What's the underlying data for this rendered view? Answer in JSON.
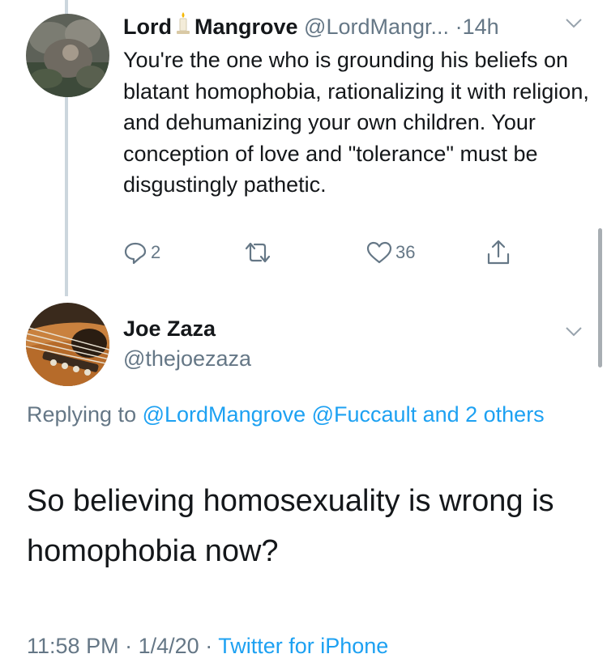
{
  "tweet1": {
    "name_first": "Lord",
    "name_last": "Mangrove",
    "handle": "@LordMangr...",
    "separator": "·",
    "time": "14h",
    "text": "You're the one who is grounding his beliefs on blatant homophobia, rationalizing it with religion, and dehumanizing your own children. Your conception of love and \"tolerance\" must be disgustingly pathetic.",
    "reply_count": "2",
    "like_count": "36",
    "icons": [
      "reply-icon",
      "retweet-icon",
      "like-icon",
      "share-icon",
      "chevron-down-icon",
      "candle-icon"
    ]
  },
  "tweet2": {
    "name": "Joe Zaza",
    "handle": "@thejoezaza",
    "replying_prefix": "Replying to",
    "replying_to": "@LordMangrove @Fuccault and 2 others",
    "text": "So believing homosexuality is wrong is homophobia now?",
    "time": "11:58 PM",
    "sep1": "·",
    "date": "1/4/20",
    "sep2": "·",
    "source": "Twitter for iPhone"
  },
  "colors": {
    "text": "#14171a",
    "muted": "#657786",
    "link": "#1da1f2",
    "divider": "#ccd6dd"
  }
}
